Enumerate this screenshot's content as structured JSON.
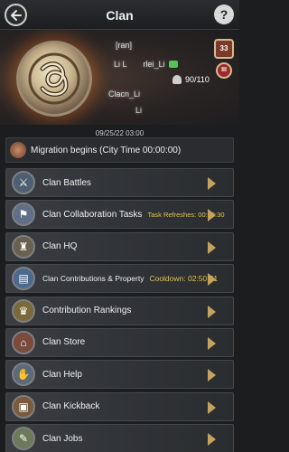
{
  "header": {
    "title": "Clan",
    "help_label": "?"
  },
  "banner": {
    "name_line": "[ran]",
    "line2_a": "Li L",
    "line2_b": "rlei_Li",
    "line3_count": "90/110",
    "line4": "Clacn_Li",
    "line5": "Li",
    "badge_level": "33",
    "rank_label": "III"
  },
  "notice": {
    "date": "09/25/22 03:00",
    "text": "Migration begins (City Time 00:00:00)"
  },
  "menu": [
    {
      "label": "Clan Battles",
      "icon": "helmet-icon"
    },
    {
      "label": "Clan Collaboration Tasks",
      "extra": "Task Refreshes: 00:45:30",
      "icon": "flag-icon"
    },
    {
      "label": "Clan HQ",
      "icon": "castle-icon"
    },
    {
      "label": "Clan Contributions & Property",
      "extra": "Cooldown: 02:50:21",
      "icon": "book-icon"
    },
    {
      "label": "Contribution Rankings",
      "icon": "trophy-icon"
    },
    {
      "label": "Clan Store",
      "icon": "store-icon"
    },
    {
      "label": "Clan Help",
      "icon": "handshake-icon"
    },
    {
      "label": "Clan Kickback",
      "icon": "chest-icon"
    },
    {
      "label": "Clan Jobs",
      "icon": "jobs-icon"
    }
  ],
  "colors": {
    "accent": "#e8c14a",
    "chevron": "#c7a25a"
  }
}
